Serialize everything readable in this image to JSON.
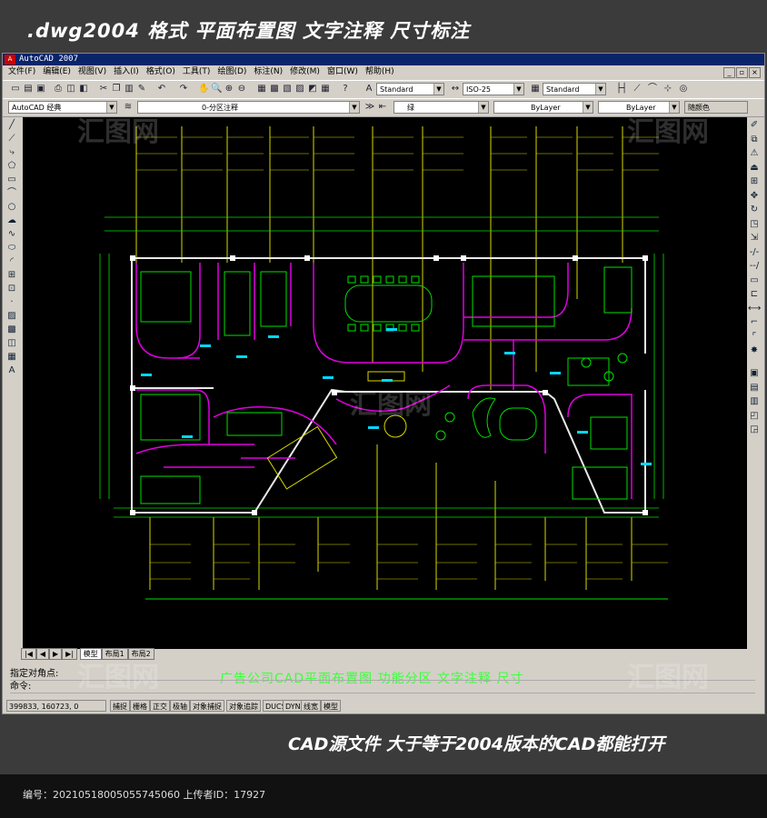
{
  "top_banner": {
    "text": ".dwg2004 格式  平面布置图 文字注释 尺寸标注"
  },
  "app": {
    "title": "AutoCAD 2007",
    "menus": [
      "文件(F)",
      "编辑(E)",
      "视图(V)",
      "插入(I)",
      "格式(O)",
      "工具(T)",
      "绘图(D)",
      "标注(N)",
      "修改(M)",
      "窗口(W)",
      "帮助(H)"
    ],
    "workspace": "AutoCAD 经典",
    "layer": "0-分区注释",
    "text_style": "Standard",
    "dim_style": "ISO-25",
    "table_style": "Standard",
    "color": "绿",
    "linetype": "ByLayer",
    "lineweight": "ByLayer",
    "plot_style": "随颜色"
  },
  "drawing": {
    "caption": "广告公司CAD平面布置图   功能分区   文字注释   尺寸"
  },
  "tabs": [
    "模型",
    "布局1",
    "布局2"
  ],
  "command": {
    "line1": "指定对角点:",
    "line2": "命令:"
  },
  "status": {
    "coords": "399833, 160723, 0",
    "buttons": [
      "捕捉",
      "栅格",
      "正交",
      "极轴",
      "对象捕捉",
      "对象追踪",
      "DUCS",
      "DYN",
      "线宽",
      "模型"
    ]
  },
  "bottom_banner": {
    "text": "CAD源文件  大于等于2004版本的CAD都能打开"
  },
  "footer": {
    "text": "编号：20210518005055745060 上传者ID：17927"
  },
  "watermark": "汇图网"
}
